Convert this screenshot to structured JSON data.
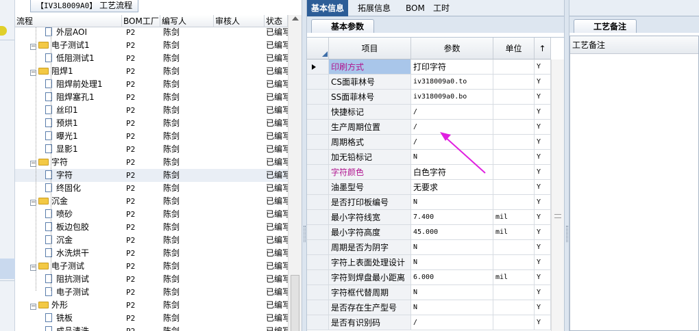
{
  "left_strip": {
    "indicator_color": "#e0cf2a"
  },
  "tree_panel": {
    "tab_code": "【IV3L8009A0】",
    "tab_label": "工艺流程",
    "columns": [
      "流程",
      "BOM工厂",
      "编写人",
      "审核人",
      "状态"
    ],
    "rows": [
      {
        "name": "外层AOI",
        "type": "doc",
        "bom": "P2",
        "author": "陈剑",
        "reviewer": "",
        "status": "已编写"
      },
      {
        "name": "电子测试1",
        "type": "folder",
        "bom": "P2",
        "author": "陈剑",
        "reviewer": "",
        "status": "已编写"
      },
      {
        "name": "低阻测试1",
        "type": "doc",
        "bom": "P2",
        "author": "陈剑",
        "reviewer": "",
        "status": "已编写"
      },
      {
        "name": "阻焊1",
        "type": "folder",
        "bom": "P2",
        "author": "陈剑",
        "reviewer": "",
        "status": "已编写"
      },
      {
        "name": "阻焊前处理1",
        "type": "doc",
        "bom": "P2",
        "author": "陈剑",
        "reviewer": "",
        "status": "已编写"
      },
      {
        "name": "阻焊塞孔1",
        "type": "doc",
        "bom": "P2",
        "author": "陈剑",
        "reviewer": "",
        "status": "已编写"
      },
      {
        "name": "丝印1",
        "type": "doc",
        "bom": "P2",
        "author": "陈剑",
        "reviewer": "",
        "status": "已编写"
      },
      {
        "name": "预烘1",
        "type": "doc",
        "bom": "P2",
        "author": "陈剑",
        "reviewer": "",
        "status": "已编写"
      },
      {
        "name": "曝光1",
        "type": "doc",
        "bom": "P2",
        "author": "陈剑",
        "reviewer": "",
        "status": "已编写"
      },
      {
        "name": "显影1",
        "type": "doc",
        "bom": "P2",
        "author": "陈剑",
        "reviewer": "",
        "status": "已编写"
      },
      {
        "name": "字符",
        "type": "folder",
        "bom": "P2",
        "author": "陈剑",
        "reviewer": "",
        "status": "已编写"
      },
      {
        "name": "字符",
        "type": "doc",
        "bom": "P2",
        "author": "陈剑",
        "reviewer": "",
        "status": "已编写",
        "selected": true
      },
      {
        "name": "终固化",
        "type": "doc",
        "bom": "P2",
        "author": "陈剑",
        "reviewer": "",
        "status": "已编写"
      },
      {
        "name": "沉金",
        "type": "folder",
        "bom": "P2",
        "author": "陈剑",
        "reviewer": "",
        "status": "已编写"
      },
      {
        "name": "喷砂",
        "type": "doc",
        "bom": "P2",
        "author": "陈剑",
        "reviewer": "",
        "status": "已编写"
      },
      {
        "name": "板边包胶",
        "type": "doc",
        "bom": "P2",
        "author": "陈剑",
        "reviewer": "",
        "status": "已编写"
      },
      {
        "name": "沉金",
        "type": "doc",
        "bom": "P2",
        "author": "陈剑",
        "reviewer": "",
        "status": "已编写"
      },
      {
        "name": "水洗烘干",
        "type": "doc",
        "bom": "P2",
        "author": "陈剑",
        "reviewer": "",
        "status": "已编写"
      },
      {
        "name": "电子测试",
        "type": "folder",
        "bom": "P2",
        "author": "陈剑",
        "reviewer": "",
        "status": "已编写"
      },
      {
        "name": "阻抗测试",
        "type": "doc",
        "bom": "P2",
        "author": "陈剑",
        "reviewer": "",
        "status": "已编写"
      },
      {
        "name": "电子测试",
        "type": "doc",
        "bom": "P2",
        "author": "陈剑",
        "reviewer": "",
        "status": "已编写"
      },
      {
        "name": "外形",
        "type": "folder",
        "bom": "P2",
        "author": "陈剑",
        "reviewer": "",
        "status": "已编写"
      },
      {
        "name": "铣板",
        "type": "doc",
        "bom": "P2",
        "author": "陈剑",
        "reviewer": "",
        "status": "已编写"
      },
      {
        "name": "成品清洗",
        "type": "doc",
        "bom": "P2",
        "author": "陈剑",
        "reviewer": "",
        "status": "已编写"
      }
    ]
  },
  "top_tabs": [
    "基本信息",
    "拓展信息",
    "BOM",
    "工时"
  ],
  "basic_params": {
    "tab_label": "基本参数",
    "columns": [
      "项目",
      "参数",
      "单位",
      "↑"
    ],
    "rows": [
      {
        "item": "印刷方式",
        "value": "打印字符",
        "unit": "",
        "flag": "Y",
        "pink": true,
        "selected": true
      },
      {
        "item": "CS面菲林号",
        "value": "iv318009a0.to",
        "unit": "",
        "flag": "Y"
      },
      {
        "item": "SS面菲林号",
        "value": "iv318009a0.bo",
        "unit": "",
        "flag": "Y"
      },
      {
        "item": "快捷标记",
        "value": "/",
        "unit": "",
        "flag": "Y"
      },
      {
        "item": "生产周期位置",
        "value": "/",
        "unit": "",
        "flag": "Y"
      },
      {
        "item": "周期格式",
        "value": "/",
        "unit": "",
        "flag": "Y"
      },
      {
        "item": "加无铅标记",
        "value": "N",
        "unit": "",
        "flag": "Y"
      },
      {
        "item": "字符颜色",
        "value": "白色字符",
        "unit": "",
        "flag": "Y",
        "pink": true
      },
      {
        "item": "油墨型号",
        "value": "无要求",
        "unit": "",
        "flag": "Y"
      },
      {
        "item": "是否打印板编号",
        "value": "N",
        "unit": "",
        "flag": "Y"
      },
      {
        "item": "最小字符线宽",
        "value": "7.400",
        "unit": "mil",
        "flag": "Y"
      },
      {
        "item": "最小字符高度",
        "value": "45.000",
        "unit": "mil",
        "flag": "Y"
      },
      {
        "item": "周期是否为阴字",
        "value": "N",
        "unit": "",
        "flag": "Y"
      },
      {
        "item": "字符上表面处理设计",
        "value": "N",
        "unit": "",
        "flag": "Y"
      },
      {
        "item": "字符到焊盘最小距离",
        "value": "6.000",
        "unit": "mil",
        "flag": "Y"
      },
      {
        "item": "字符框代替周期",
        "value": "N",
        "unit": "",
        "flag": "Y"
      },
      {
        "item": "是否存在生产型号",
        "value": "N",
        "unit": "",
        "flag": "Y"
      },
      {
        "item": "是否有识别码",
        "value": "/",
        "unit": "",
        "flag": "Y"
      }
    ]
  },
  "notes_panel": {
    "tab_label": "工艺备注",
    "header": "工艺备注"
  },
  "annotation": {
    "arrow_color": "#e020e0"
  }
}
